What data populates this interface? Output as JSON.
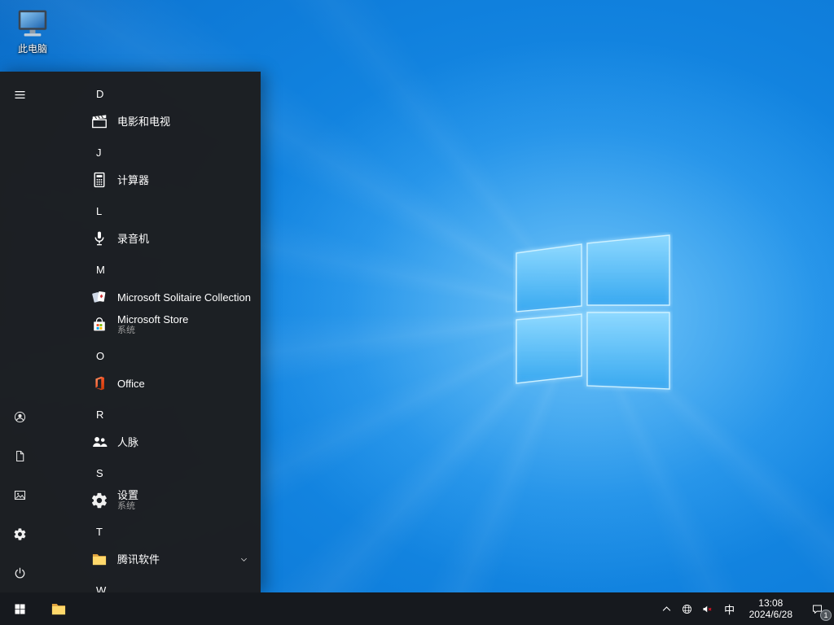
{
  "colors": {
    "accent_blue": "#0078d7",
    "wallpaper_blue": "#0f7ad8",
    "start_menu_bg": "#1d1e20",
    "taskbar_bg": "#16191e",
    "folder_yellow": "#ffd86b",
    "office_orange": "#e8461e",
    "mute_red": "#e81123"
  },
  "desktop": {
    "icon": "this-pc",
    "label": "此电脑"
  },
  "start_menu": {
    "rail": {
      "top": [
        {
          "name": "menu",
          "icon": "hamburger"
        }
      ],
      "bottom": [
        {
          "name": "account",
          "icon": "user"
        },
        {
          "name": "documents",
          "icon": "document"
        },
        {
          "name": "pictures",
          "icon": "pictures"
        },
        {
          "name": "settings",
          "icon": "gear"
        },
        {
          "name": "power",
          "icon": "power"
        }
      ]
    },
    "app_list": [
      {
        "type": "letter",
        "label": "D"
      },
      {
        "type": "app",
        "key": "movies-tv",
        "label": "电影和电视",
        "icon": "movies-tv"
      },
      {
        "type": "letter",
        "label": "J"
      },
      {
        "type": "app",
        "key": "calculator",
        "label": "计算器",
        "icon": "calculator"
      },
      {
        "type": "letter",
        "label": "L"
      },
      {
        "type": "app",
        "key": "voice-recorder",
        "label": "录音机",
        "icon": "voice-recorder"
      },
      {
        "type": "letter",
        "label": "M"
      },
      {
        "type": "app",
        "key": "microsoft-solitaire-collection",
        "label": "Microsoft Solitaire Collection",
        "icon": "solitaire"
      },
      {
        "type": "app",
        "key": "microsoft-store",
        "label": "Microsoft Store",
        "subtitle": "系统",
        "icon": "store"
      },
      {
        "type": "letter",
        "label": "O"
      },
      {
        "type": "app",
        "key": "office",
        "label": "Office",
        "icon": "office"
      },
      {
        "type": "letter",
        "label": "R"
      },
      {
        "type": "app",
        "key": "people",
        "label": "人脉",
        "icon": "people"
      },
      {
        "type": "letter",
        "label": "S"
      },
      {
        "type": "app",
        "key": "settings",
        "label": "设置",
        "subtitle": "系统",
        "icon": "gear"
      },
      {
        "type": "letter",
        "label": "T"
      },
      {
        "type": "app",
        "key": "tencent-software",
        "label": "腾讯软件",
        "icon": "folder",
        "expandable": true
      },
      {
        "type": "letter",
        "label": "W"
      }
    ]
  },
  "taskbar": {
    "start": {
      "name": "start",
      "icon": "windows"
    },
    "apps": [
      {
        "name": "file-explorer",
        "icon": "folder"
      }
    ],
    "tray": {
      "chevron_icon": "chevron-up",
      "network_icon": "network",
      "volume_icon": "volume-muted",
      "ime_label": "中",
      "time": "13:08",
      "date": "2024/6/28",
      "notification_icon": "notification",
      "notification_badge": "1"
    }
  }
}
